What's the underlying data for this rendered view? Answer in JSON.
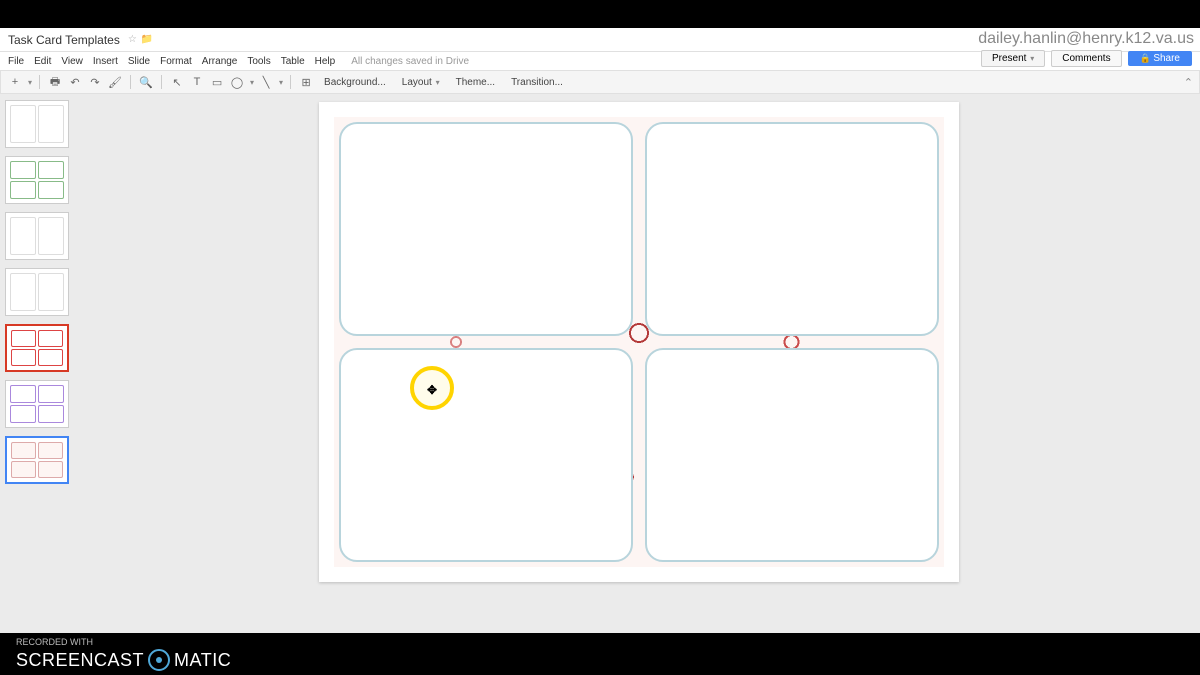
{
  "doc": {
    "title": "Task Card Templates",
    "user_email": "dailey.hanlin@henry.k12.va.us"
  },
  "menu": {
    "items": [
      "File",
      "Edit",
      "View",
      "Insert",
      "Slide",
      "Format",
      "Arrange",
      "Tools",
      "Table",
      "Help"
    ],
    "save_status": "All changes saved in Drive"
  },
  "toolbar": {
    "background": "Background...",
    "layout": "Layout",
    "theme": "Theme...",
    "transition": "Transition..."
  },
  "buttons": {
    "present": "Present",
    "comments": "Comments",
    "share": "Share"
  },
  "watermark": {
    "recorded": "RECORDED WITH",
    "brand_pre": "SCREENCAST",
    "brand_post": "MATIC"
  },
  "thumbnails": [
    {
      "id": 1,
      "type": "blank2"
    },
    {
      "id": 2,
      "type": "content"
    },
    {
      "id": 3,
      "type": "blank2"
    },
    {
      "id": 4,
      "type": "blank2"
    },
    {
      "id": 5,
      "type": "red4",
      "selected": true
    },
    {
      "id": 6,
      "type": "purple4"
    },
    {
      "id": 7,
      "type": "bubble4",
      "active": true
    }
  ]
}
